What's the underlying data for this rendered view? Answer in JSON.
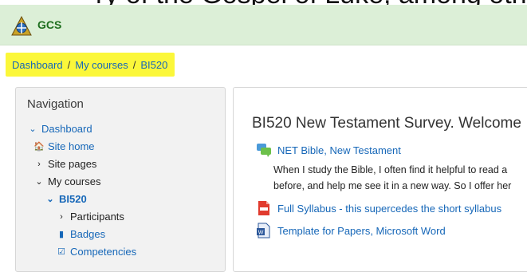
{
  "site": {
    "brand": "GCS"
  },
  "breadcrumb": {
    "items": [
      "Dashboard",
      "My courses",
      "BI520"
    ],
    "separator": "/"
  },
  "navigation": {
    "title": "Navigation",
    "items": [
      {
        "label": "Dashboard",
        "icon": "chevron-down-icon"
      },
      {
        "label": "Site home",
        "icon": "home-icon"
      },
      {
        "label": "Site pages",
        "icon": "chevron-right-icon"
      },
      {
        "label": "My courses",
        "icon": "chevron-down-icon"
      },
      {
        "label": "BI520",
        "icon": "chevron-down-icon"
      },
      {
        "label": "Participants",
        "icon": "chevron-right-icon"
      },
      {
        "label": "Badges",
        "icon": "badge-icon"
      },
      {
        "label": "Competencies",
        "icon": "checkbox-icon"
      }
    ]
  },
  "course": {
    "title": "BI520 New Testament Survey. Welcome",
    "activities": [
      {
        "label": "NET Bible, New Testament",
        "icon": "forum-icon"
      },
      {
        "label": "Full Syllabus - this supercedes the short syllabus",
        "icon": "pdf-icon"
      },
      {
        "label": "Template for Papers, Microsoft Word",
        "icon": "word-doc-icon"
      }
    ],
    "description_lines": [
      "When I study the Bible, I often find it helpful to read a",
      "before, and help me see it in a new way. So I offer her"
    ]
  },
  "colors": {
    "navbar_bg": "#dcefd7",
    "highlight": "#fbf73a",
    "link": "#1667b8",
    "brand": "#1f6f1f"
  }
}
